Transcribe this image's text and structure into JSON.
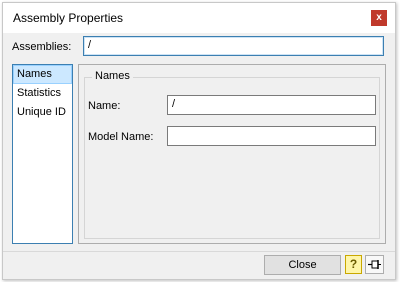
{
  "window": {
    "title": "Assembly Properties",
    "close_glyph": "x"
  },
  "assemblies": {
    "label": "Assemblies:",
    "value": "/"
  },
  "sidebar": {
    "items": [
      {
        "label": "Names",
        "selected": true
      },
      {
        "label": "Statistics",
        "selected": false
      },
      {
        "label": "Unique ID",
        "selected": false
      }
    ]
  },
  "names_group": {
    "title": "Names",
    "name_label": "Name:",
    "name_value": "/",
    "model_name_label": "Model Name:",
    "model_name_value": ""
  },
  "footer": {
    "close_label": "Close",
    "help_glyph": "?"
  },
  "icons": {
    "help": "help-icon",
    "pin": "pin-icon"
  },
  "colors": {
    "accent": "#3c7fb1",
    "close_button": "#c0392b",
    "selection": "#cce8ff"
  }
}
